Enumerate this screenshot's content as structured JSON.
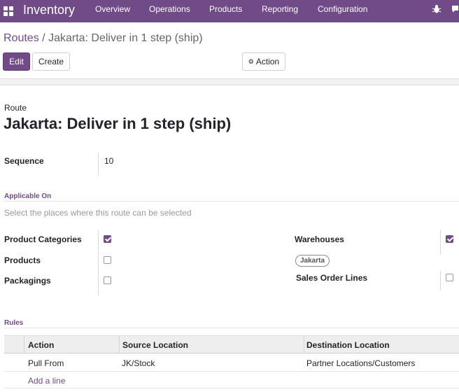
{
  "navbar": {
    "app_name": "Inventory",
    "menus": [
      "Overview",
      "Operations",
      "Products",
      "Reporting",
      "Configuration"
    ],
    "bg_color": "#714b87"
  },
  "breadcrumb": {
    "parent": "Routes",
    "separator": "/",
    "current": "Jakarta: Deliver in 1 step (ship)"
  },
  "toolbar": {
    "edit_label": "Edit",
    "create_label": "Create",
    "action_label": "Action"
  },
  "form": {
    "record_type_label": "Route",
    "title": "Jakarta: Deliver in 1 step (ship)",
    "sequence": {
      "label": "Sequence",
      "value": "10"
    },
    "applicable_on": {
      "heading": "Applicable On",
      "help": "Select the places where this route can be selected",
      "product_categories": {
        "label": "Product Categories",
        "checked": true
      },
      "products": {
        "label": "Products",
        "checked": false
      },
      "packagings": {
        "label": "Packagings",
        "checked": false
      },
      "warehouses": {
        "label": "Warehouses",
        "checked": true,
        "tags": [
          "Jakarta"
        ]
      },
      "sales_order_lines": {
        "label": "Sales Order Lines",
        "checked": false
      }
    },
    "rules": {
      "heading": "Rules",
      "columns": [
        "Action",
        "Source Location",
        "Destination Location"
      ],
      "rows": [
        {
          "action": "Pull From",
          "source": "JK/Stock",
          "destination": "Partner Locations/Customers"
        }
      ],
      "add_line_label": "Add a line"
    }
  },
  "icons": {
    "apps": "apps-grid-icon",
    "bug": "bug-icon",
    "chat": "chat-icon",
    "gear": "gear-icon"
  }
}
